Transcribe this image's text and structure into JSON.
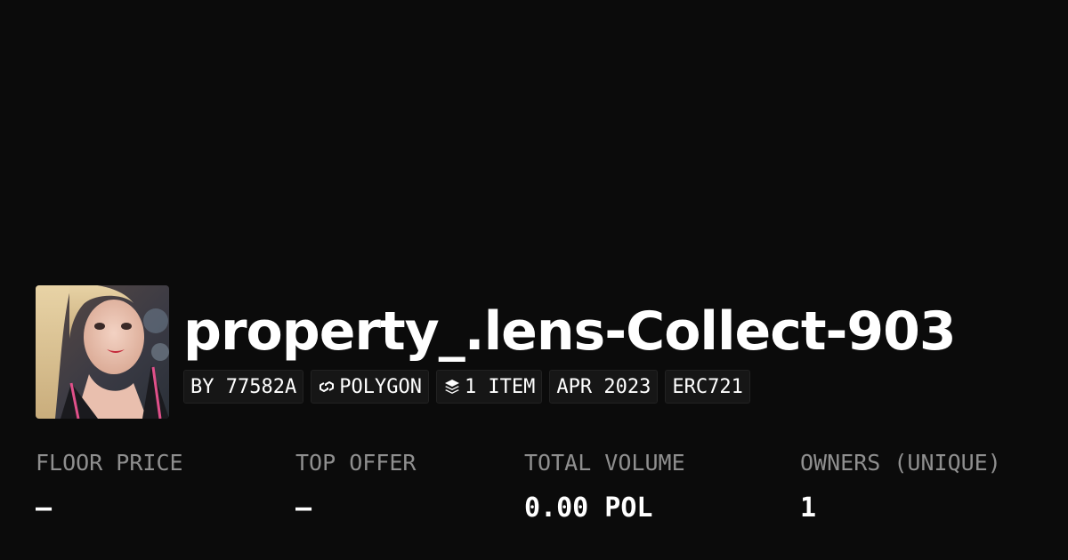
{
  "collection": {
    "title": "property_.lens-Collect-903",
    "avatar_alt": "collection avatar"
  },
  "tags": [
    {
      "label": "BY 77582A"
    },
    {
      "label": "POLYGON",
      "icon": "polygon-chain-icon"
    },
    {
      "label": "1 ITEM",
      "icon": "layers-icon"
    },
    {
      "label": "APR 2023"
    },
    {
      "label": "ERC721"
    }
  ],
  "stats": {
    "floor_price": {
      "label": "FLOOR PRICE",
      "value": "–"
    },
    "top_offer": {
      "label": "TOP OFFER",
      "value": "–"
    },
    "total_volume": {
      "label": "TOTAL VOLUME",
      "value": "0.00 POL"
    },
    "owners": {
      "label": "OWNERS (UNIQUE)",
      "value": "1"
    }
  },
  "colors": {
    "background": "#0b0b0b",
    "text": "#ffffff",
    "muted": "#8f8f8f",
    "tag_bg": "#161616"
  }
}
